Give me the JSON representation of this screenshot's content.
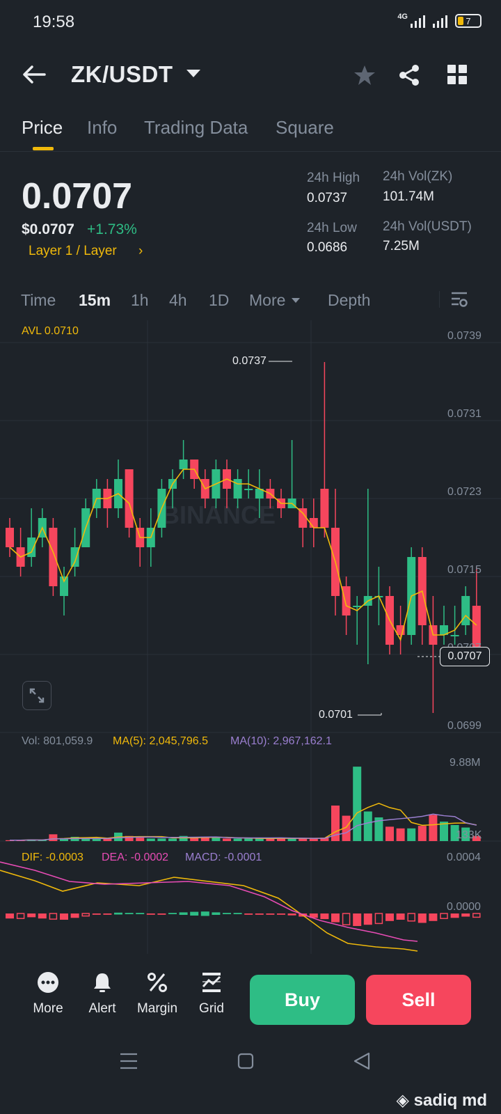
{
  "status": {
    "time": "19:58",
    "network": "4G",
    "battery": "7"
  },
  "header": {
    "pair": "ZK/USDT"
  },
  "tabs": [
    "Price",
    "Info",
    "Trading Data",
    "Square"
  ],
  "price": {
    "last": "0.0707",
    "usd": "$0.0707",
    "change": "+1.73%",
    "category": "Layer 1 / Layer",
    "high_label": "24h High",
    "high": "0.0737",
    "low_label": "24h Low",
    "low": "0.0686",
    "vol_zk_label": "24h Vol(ZK)",
    "vol_zk": "101.74M",
    "vol_usdt_label": "24h Vol(USDT)",
    "vol_usdt": "7.25M"
  },
  "intervals": [
    "Time",
    "15m",
    "1h",
    "4h",
    "1D",
    "More",
    "Depth"
  ],
  "chart": {
    "avl": "AVL 0.0710",
    "y_ticks": [
      "0.0739",
      "0.0731",
      "0.0723",
      "0.0715",
      "0.0707",
      "0.0699"
    ],
    "current_price_tag": "0.0707",
    "max_label": "0.0737",
    "min_label": "0.0701",
    "watermark": "BINANCE",
    "vol_label": "Vol: 801,059.9",
    "ma5_label": "MA(5): 2,045,796.5",
    "ma10_label": "MA(10): 2,967,162.1",
    "vol_top": "9.88M",
    "vol_bottom": "133K",
    "dif_label": "DIF: -0.0003",
    "dea_label": "DEA: -0.0002",
    "macd_label": "MACD: -0.0001",
    "macd_top": "0.0004",
    "macd_zero": "0.0000"
  },
  "chart_data": {
    "type": "candlestick",
    "ylim": [
      0.0699,
      0.0739
    ],
    "candles": [
      [
        0.072,
        0.0718,
        0.0721,
        0.0717
      ],
      [
        0.0718,
        0.0716,
        0.072,
        0.0715
      ],
      [
        0.0717,
        0.0719,
        0.0722,
        0.0716
      ],
      [
        0.0719,
        0.0721,
        0.0722,
        0.0718
      ],
      [
        0.072,
        0.0714,
        0.0721,
        0.0713
      ],
      [
        0.0713,
        0.0715,
        0.0716,
        0.0711
      ],
      [
        0.0716,
        0.0718,
        0.072,
        0.0715
      ],
      [
        0.0718,
        0.0722,
        0.0723,
        0.0718
      ],
      [
        0.0722,
        0.0724,
        0.0725,
        0.0721
      ],
      [
        0.0724,
        0.0722,
        0.0725,
        0.072
      ],
      [
        0.0722,
        0.0725,
        0.0727,
        0.0721
      ],
      [
        0.0726,
        0.072,
        0.0726,
        0.0719
      ],
      [
        0.072,
        0.0718,
        0.0721,
        0.0716
      ],
      [
        0.0718,
        0.072,
        0.0722,
        0.0716
      ],
      [
        0.072,
        0.0724,
        0.0725,
        0.0719
      ],
      [
        0.0724,
        0.0725,
        0.0726,
        0.0722
      ],
      [
        0.0726,
        0.0727,
        0.0729,
        0.0725
      ],
      [
        0.0727,
        0.0725,
        0.0727,
        0.0724
      ],
      [
        0.0725,
        0.0723,
        0.0726,
        0.0722
      ],
      [
        0.0723,
        0.0726,
        0.0727,
        0.0722
      ],
      [
        0.0726,
        0.0724,
        0.0727,
        0.0722
      ],
      [
        0.0723,
        0.0725,
        0.0726,
        0.0722
      ],
      [
        0.0724,
        0.0724,
        0.0726,
        0.0723
      ],
      [
        0.0723,
        0.0724,
        0.0726,
        0.0721
      ],
      [
        0.0724,
        0.0723,
        0.0725,
        0.0722
      ],
      [
        0.0723,
        0.0722,
        0.0724,
        0.0721
      ],
      [
        0.0722,
        0.0723,
        0.0729,
        0.0722
      ],
      [
        0.0722,
        0.072,
        0.0723,
        0.0718
      ],
      [
        0.0721,
        0.072,
        0.0723,
        0.0718
      ],
      [
        0.0724,
        0.072,
        0.0737,
        0.0719
      ],
      [
        0.072,
        0.0713,
        0.0724,
        0.0711
      ],
      [
        0.0714,
        0.0711,
        0.0715,
        0.0709
      ],
      [
        0.0712,
        0.0712,
        0.0713,
        0.0708
      ],
      [
        0.0712,
        0.0713,
        0.0724,
        0.0706
      ],
      [
        0.0713,
        0.0713,
        0.0716,
        0.071
      ],
      [
        0.0713,
        0.0708,
        0.0714,
        0.0707
      ],
      [
        0.071,
        0.0709,
        0.0712,
        0.0707
      ],
      [
        0.0709,
        0.0717,
        0.0718,
        0.0708
      ],
      [
        0.0717,
        0.071,
        0.0718,
        0.0708
      ],
      [
        0.071,
        0.0708,
        0.0713,
        0.0701
      ],
      [
        0.0709,
        0.071,
        0.0712,
        0.0708
      ],
      [
        0.0709,
        0.0709,
        0.0712,
        0.0708
      ],
      [
        0.071,
        0.0713,
        0.0714,
        0.0709
      ],
      [
        0.0712,
        0.0707,
        0.0716,
        0.0706
      ]
    ],
    "volume": [
      0.1,
      0.1,
      0.2,
      0.1,
      0.8,
      0.3,
      0.5,
      0.3,
      0.3,
      0.3,
      1.0,
      0.6,
      0.4,
      0.3,
      0.3,
      0.3,
      0.6,
      0.4,
      0.5,
      0.4,
      0.3,
      0.3,
      0.3,
      0.3,
      0.3,
      0.4,
      0.3,
      0.3,
      0.3,
      0.4,
      4.2,
      3.0,
      8.8,
      3.5,
      2.8,
      1.7,
      1.5,
      1.5,
      1.8,
      3.1,
      2.3,
      1.9,
      1.6,
      0.6
    ],
    "volume_unit": "M"
  }
}
